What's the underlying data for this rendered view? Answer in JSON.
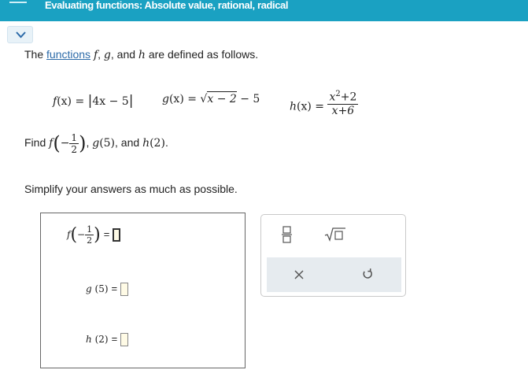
{
  "header": {
    "title": "Evaluating functions: Absolute value, rational, radical"
  },
  "intro": {
    "prefix": "The ",
    "link": "functions",
    "f": "f",
    "sep1": ", ",
    "g": "g",
    "sep2": ", and ",
    "h": "h",
    "suffix": " are defined as follows."
  },
  "definitions": {
    "f": {
      "lhs": "f",
      "arg": "(x) = ",
      "body": "4x − 5"
    },
    "g": {
      "lhs": "g",
      "arg": "(x) = ",
      "radicand": "x − 2",
      "tail": " − 5"
    },
    "h": {
      "lhs": "h",
      "arg": "(x) = ",
      "numerator": "x",
      "exponent": "2",
      "num_tail": "+2",
      "denominator": "x+6"
    }
  },
  "find": {
    "prefix": "Find ",
    "f": "f",
    "neg": "−",
    "num": "1",
    "den": "2",
    "g": "g",
    "g_arg": "(5)",
    "sep": ", and ",
    "h": "h",
    "h_arg": "(2)",
    "end": "."
  },
  "simplify": "Simplify your answers as much as possible.",
  "answers": {
    "f_label": "f",
    "f_neg": "−",
    "f_num": "1",
    "f_den": "2",
    "g_label": "g",
    "g_arg": "(5)",
    "h_label": "h",
    "h_arg": "(2)",
    "equals": "="
  },
  "toolbar": {
    "icons": [
      "fraction-icon",
      "square-root-icon",
      "clear-icon",
      "undo-icon"
    ]
  }
}
